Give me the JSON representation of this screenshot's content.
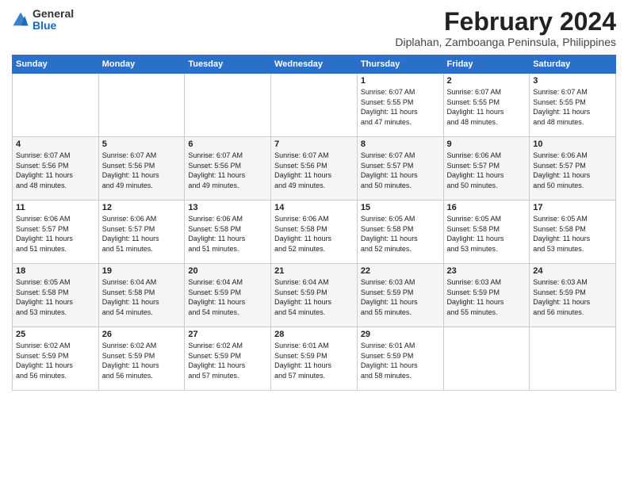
{
  "header": {
    "logo_general": "General",
    "logo_blue": "Blue",
    "month_title": "February 2024",
    "location": "Diplahan, Zamboanga Peninsula, Philippines"
  },
  "weekdays": [
    "Sunday",
    "Monday",
    "Tuesday",
    "Wednesday",
    "Thursday",
    "Friday",
    "Saturday"
  ],
  "weeks": [
    [
      {
        "day": "",
        "info": ""
      },
      {
        "day": "",
        "info": ""
      },
      {
        "day": "",
        "info": ""
      },
      {
        "day": "",
        "info": ""
      },
      {
        "day": "1",
        "info": "Sunrise: 6:07 AM\nSunset: 5:55 PM\nDaylight: 11 hours\nand 47 minutes."
      },
      {
        "day": "2",
        "info": "Sunrise: 6:07 AM\nSunset: 5:55 PM\nDaylight: 11 hours\nand 48 minutes."
      },
      {
        "day": "3",
        "info": "Sunrise: 6:07 AM\nSunset: 5:55 PM\nDaylight: 11 hours\nand 48 minutes."
      }
    ],
    [
      {
        "day": "4",
        "info": "Sunrise: 6:07 AM\nSunset: 5:56 PM\nDaylight: 11 hours\nand 48 minutes."
      },
      {
        "day": "5",
        "info": "Sunrise: 6:07 AM\nSunset: 5:56 PM\nDaylight: 11 hours\nand 49 minutes."
      },
      {
        "day": "6",
        "info": "Sunrise: 6:07 AM\nSunset: 5:56 PM\nDaylight: 11 hours\nand 49 minutes."
      },
      {
        "day": "7",
        "info": "Sunrise: 6:07 AM\nSunset: 5:56 PM\nDaylight: 11 hours\nand 49 minutes."
      },
      {
        "day": "8",
        "info": "Sunrise: 6:07 AM\nSunset: 5:57 PM\nDaylight: 11 hours\nand 50 minutes."
      },
      {
        "day": "9",
        "info": "Sunrise: 6:06 AM\nSunset: 5:57 PM\nDaylight: 11 hours\nand 50 minutes."
      },
      {
        "day": "10",
        "info": "Sunrise: 6:06 AM\nSunset: 5:57 PM\nDaylight: 11 hours\nand 50 minutes."
      }
    ],
    [
      {
        "day": "11",
        "info": "Sunrise: 6:06 AM\nSunset: 5:57 PM\nDaylight: 11 hours\nand 51 minutes."
      },
      {
        "day": "12",
        "info": "Sunrise: 6:06 AM\nSunset: 5:57 PM\nDaylight: 11 hours\nand 51 minutes."
      },
      {
        "day": "13",
        "info": "Sunrise: 6:06 AM\nSunset: 5:58 PM\nDaylight: 11 hours\nand 51 minutes."
      },
      {
        "day": "14",
        "info": "Sunrise: 6:06 AM\nSunset: 5:58 PM\nDaylight: 11 hours\nand 52 minutes."
      },
      {
        "day": "15",
        "info": "Sunrise: 6:05 AM\nSunset: 5:58 PM\nDaylight: 11 hours\nand 52 minutes."
      },
      {
        "day": "16",
        "info": "Sunrise: 6:05 AM\nSunset: 5:58 PM\nDaylight: 11 hours\nand 53 minutes."
      },
      {
        "day": "17",
        "info": "Sunrise: 6:05 AM\nSunset: 5:58 PM\nDaylight: 11 hours\nand 53 minutes."
      }
    ],
    [
      {
        "day": "18",
        "info": "Sunrise: 6:05 AM\nSunset: 5:58 PM\nDaylight: 11 hours\nand 53 minutes."
      },
      {
        "day": "19",
        "info": "Sunrise: 6:04 AM\nSunset: 5:58 PM\nDaylight: 11 hours\nand 54 minutes."
      },
      {
        "day": "20",
        "info": "Sunrise: 6:04 AM\nSunset: 5:59 PM\nDaylight: 11 hours\nand 54 minutes."
      },
      {
        "day": "21",
        "info": "Sunrise: 6:04 AM\nSunset: 5:59 PM\nDaylight: 11 hours\nand 54 minutes."
      },
      {
        "day": "22",
        "info": "Sunrise: 6:03 AM\nSunset: 5:59 PM\nDaylight: 11 hours\nand 55 minutes."
      },
      {
        "day": "23",
        "info": "Sunrise: 6:03 AM\nSunset: 5:59 PM\nDaylight: 11 hours\nand 55 minutes."
      },
      {
        "day": "24",
        "info": "Sunrise: 6:03 AM\nSunset: 5:59 PM\nDaylight: 11 hours\nand 56 minutes."
      }
    ],
    [
      {
        "day": "25",
        "info": "Sunrise: 6:02 AM\nSunset: 5:59 PM\nDaylight: 11 hours\nand 56 minutes."
      },
      {
        "day": "26",
        "info": "Sunrise: 6:02 AM\nSunset: 5:59 PM\nDaylight: 11 hours\nand 56 minutes."
      },
      {
        "day": "27",
        "info": "Sunrise: 6:02 AM\nSunset: 5:59 PM\nDaylight: 11 hours\nand 57 minutes."
      },
      {
        "day": "28",
        "info": "Sunrise: 6:01 AM\nSunset: 5:59 PM\nDaylight: 11 hours\nand 57 minutes."
      },
      {
        "day": "29",
        "info": "Sunrise: 6:01 AM\nSunset: 5:59 PM\nDaylight: 11 hours\nand 58 minutes."
      },
      {
        "day": "",
        "info": ""
      },
      {
        "day": "",
        "info": ""
      }
    ]
  ]
}
